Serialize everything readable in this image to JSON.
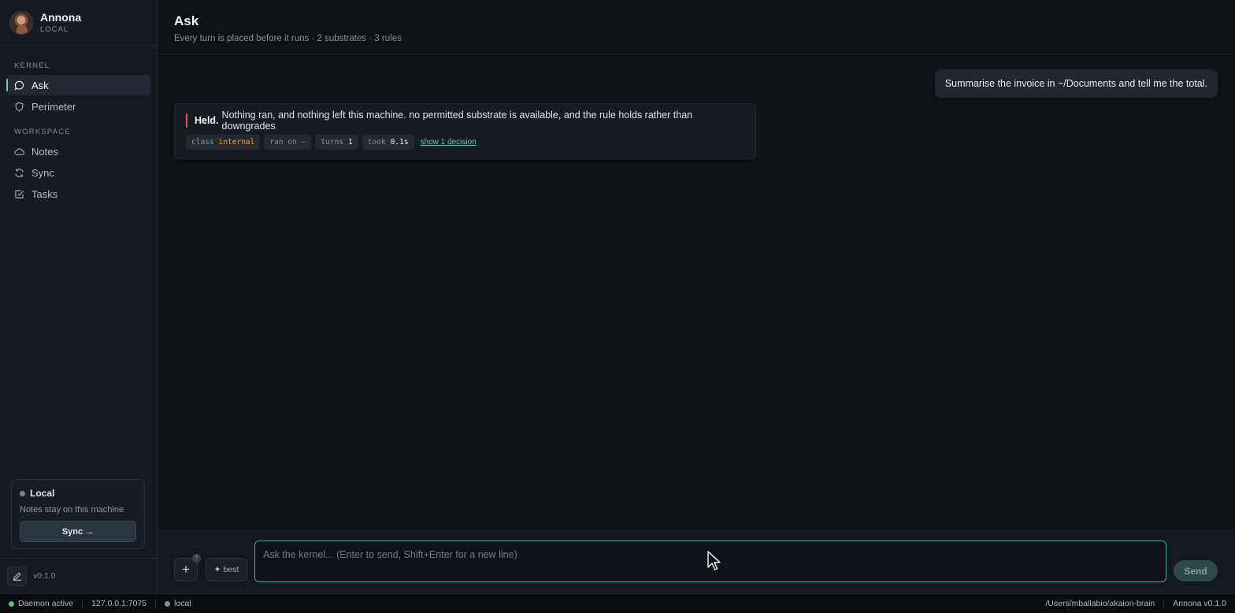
{
  "brand": {
    "name": "Annona",
    "mode": "LOCAL"
  },
  "sidebar": {
    "kernel_label": "KERNEL",
    "kernel_items": [
      {
        "label": "Ask",
        "icon": "chat-bubble-icon",
        "active": true
      },
      {
        "label": "Perimeter",
        "icon": "shield-icon",
        "active": false
      }
    ],
    "workspace_label": "WORKSPACE",
    "workspace_items": [
      {
        "label": "Notes",
        "icon": "cloud-icon"
      },
      {
        "label": "Sync",
        "icon": "refresh-icon"
      },
      {
        "label": "Tasks",
        "icon": "checkbox-icon"
      }
    ],
    "local_card": {
      "title": "Local",
      "note": "Notes stay on this machine",
      "sync_label": "Sync →"
    },
    "version": "v0.1.0"
  },
  "header": {
    "title": "Ask",
    "subtitle": "Every turn is placed before it runs · 2 substrates · 3 rules"
  },
  "conversation": {
    "user_message": "Summarise the invoice in ~/Documents and tell me the total.",
    "reply": {
      "status": "Held.",
      "text": "Nothing ran, and nothing left this machine. no permitted substrate is available, and the rule holds rather than downgrades",
      "chips": [
        {
          "key": "class",
          "value": "internal",
          "tone": "amber"
        },
        {
          "key": "ran on",
          "value": "—",
          "tone": "red"
        },
        {
          "key": "turns",
          "value": "1",
          "tone": "normal"
        },
        {
          "key": "took",
          "value": "0.1s",
          "tone": "normal"
        }
      ],
      "decision_link": "show 1 decision"
    }
  },
  "composer": {
    "plus_label": "+",
    "plus_badge": "?",
    "best_label": "best",
    "placeholder": "Ask the kernel... (Enter to send, Shift+Enter for a new line)",
    "send_label": "Send"
  },
  "statusbar": {
    "daemon": "Daemon active",
    "address": "127.0.0.1:7075",
    "mode": "local",
    "path": "/Users/mballabio/akaion-brain",
    "app_version": "Annona v0.1.0"
  },
  "colors": {
    "accent": "#5fd0c3",
    "held": "#e0594c",
    "amber": "#e2a93b",
    "daemon_active": "#3ecf6e"
  }
}
